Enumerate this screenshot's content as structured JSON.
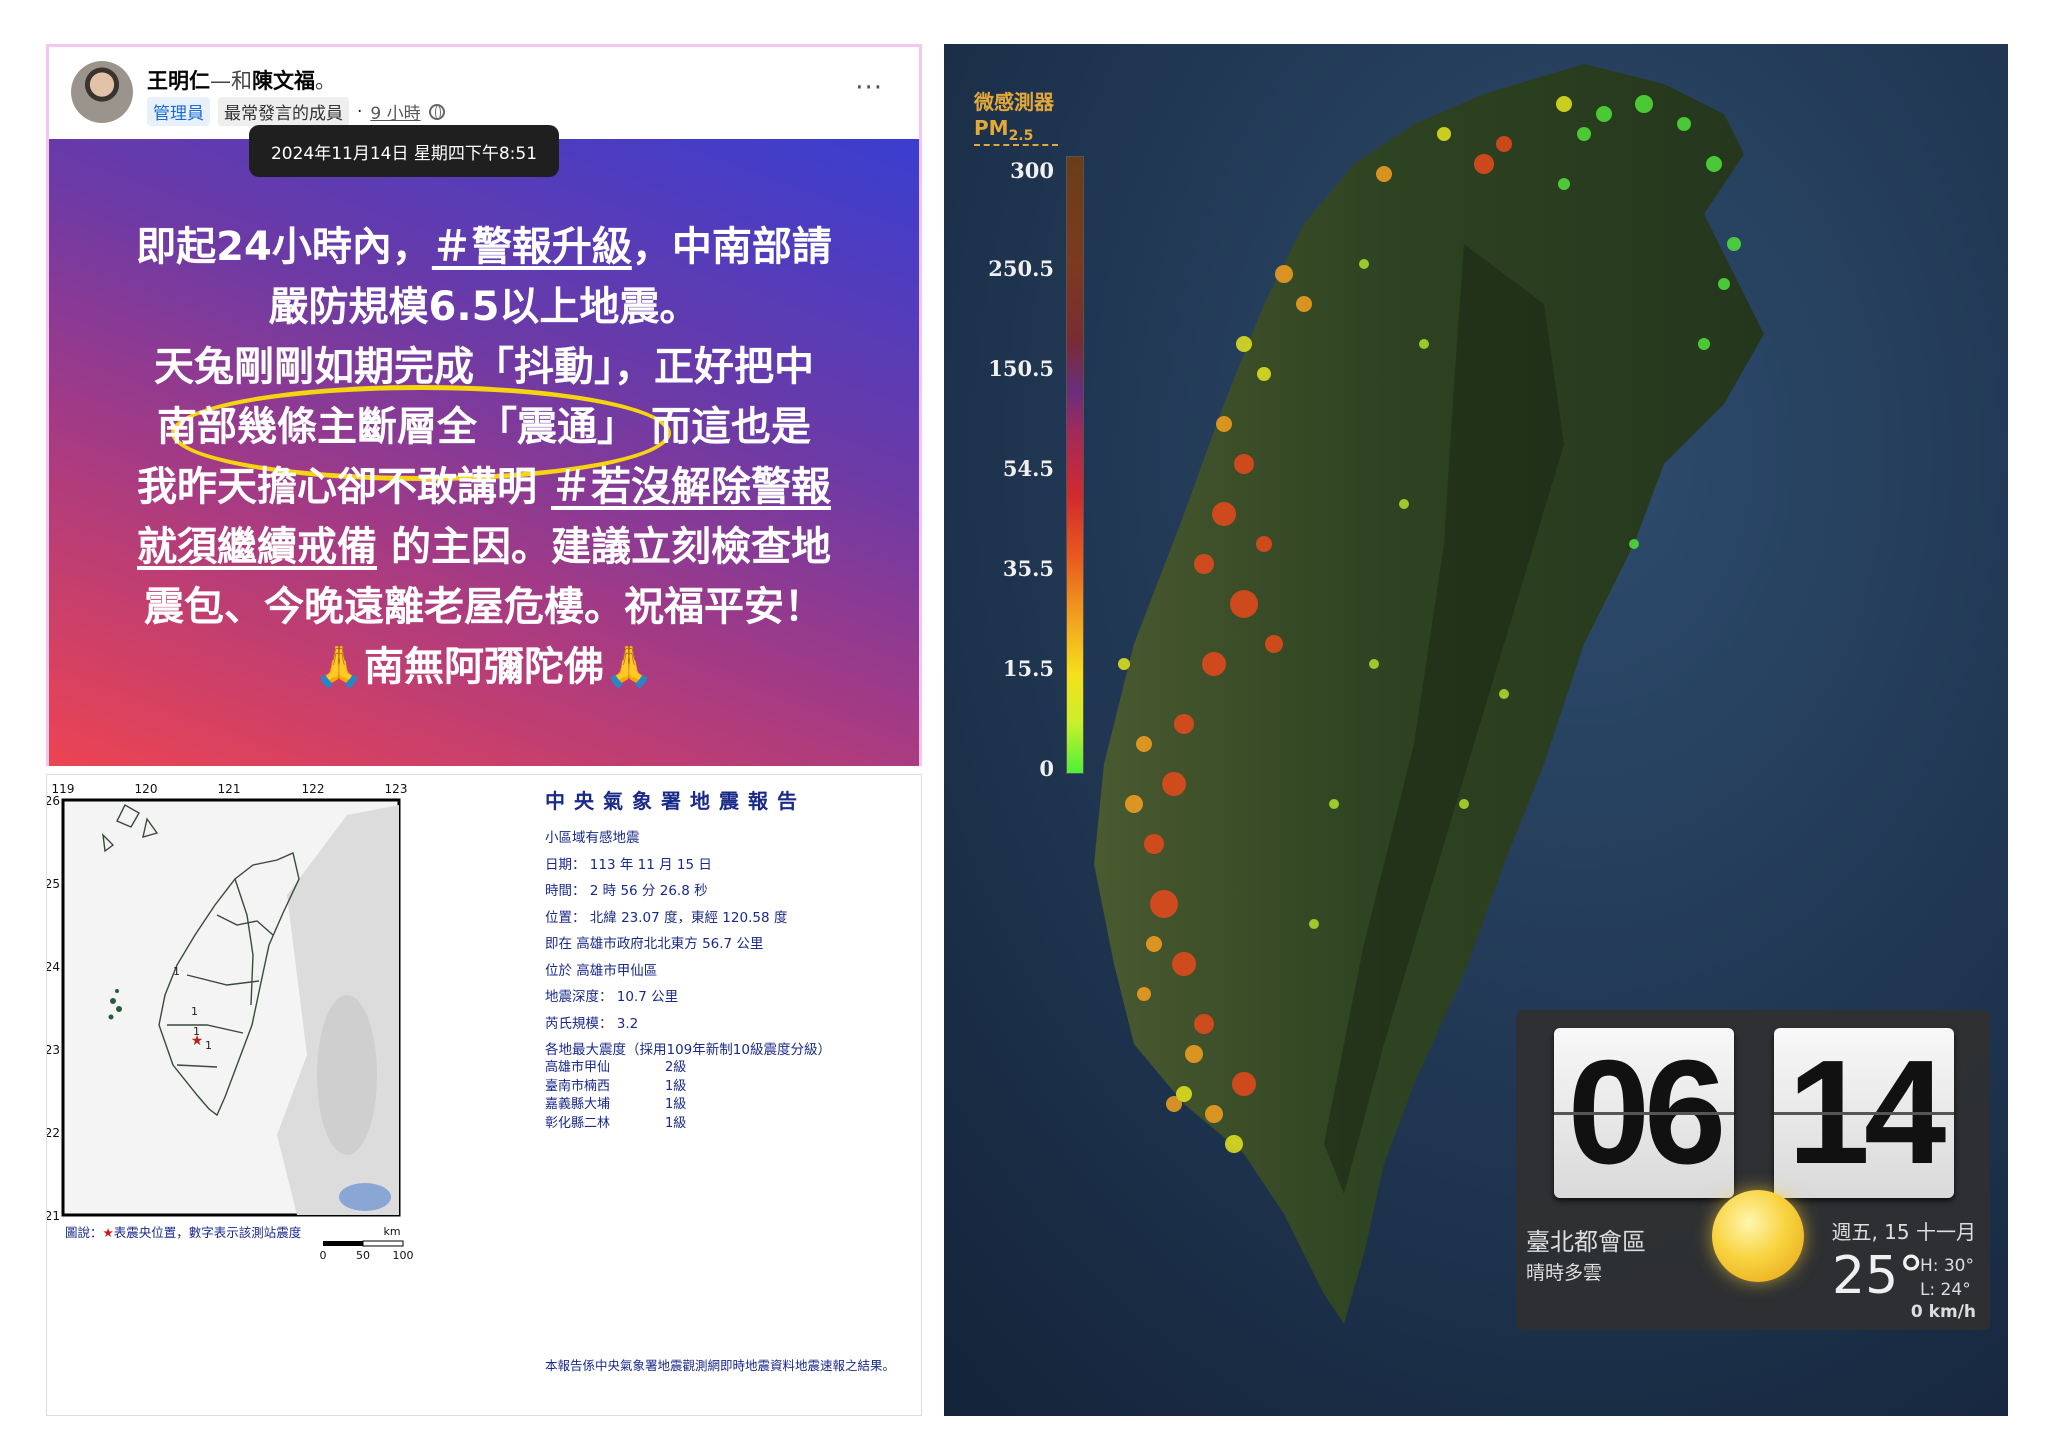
{
  "post": {
    "author": "王明仁",
    "with_text": "—和",
    "tagged": "陳文福",
    "suffix": "。",
    "role_badge": "管理員",
    "member_badge": "最常發言的成員",
    "separator": "·",
    "time": "9 小時",
    "more": "···",
    "tooltip": "2024年11月14日 星期四下午8:51",
    "body": {
      "l1a": "即起24小時內，",
      "l1tag": "＃警報升級",
      "l1b": "，中南部請",
      "l2": "嚴防規模6.5以上地震。",
      "l3": "天兔剛剛如期完成「抖動」，正好把中",
      "l4": "南部幾條主斷層全「震通」  而這也是",
      "l5a": "我昨天擔心卻不敢講明 ",
      "l5tag": "＃若沒解除警報",
      "l6tag": "就須繼續戒備",
      "l6b": " 的主因。建議立刻檢查地",
      "l7": "震包、今晚遠離老屋危樓。祝福平安！",
      "l8_pray": "🙏",
      "l8": "南無阿彌陀佛"
    }
  },
  "report": {
    "title": "中央氣象署地震報告",
    "subtitle": "小區域有感地震",
    "date": "日期： 113 年 11 月 15 日",
    "time": "時間： 2 時 56 分 26.8 秒",
    "position": "位置： 北緯 23.07 度，東經 120.58 度",
    "at": "即在 高雄市政府北北東方 56.7 公里",
    "located": "位於 高雄市甲仙區",
    "depth": "地震深度： 10.7 公里",
    "magnitude": "芮氏規模： 3.2",
    "intensity_header": "各地最大震度（採用109年新制10級震度分級）",
    "intensities": [
      {
        "loc": "高雄市甲仙",
        "level": "2級"
      },
      {
        "loc": "臺南市楠西",
        "level": "1級"
      },
      {
        "loc": "嘉義縣大埔",
        "level": "1級"
      },
      {
        "loc": "彰化縣二林",
        "level": "1級"
      }
    ],
    "footnote": "本報告係中央氣象署地震觀測網即時地震資料地震速報之結果。",
    "map_legend_prefix": "圖說：",
    "map_legend_star": "★",
    "map_legend": "表震央位置，數字表示該測站震度",
    "scale_unit": "km",
    "scale_ticks": [
      "0",
      "50",
      "100"
    ],
    "lon_ticks": [
      "119",
      "120",
      "121",
      "122",
      "123"
    ],
    "lat_ticks": [
      "26",
      "25",
      "24",
      "23",
      "22",
      "21"
    ],
    "station_labels": [
      "1",
      "1",
      "1",
      "1"
    ]
  },
  "pm_map": {
    "sensor_label": "微感測器",
    "pm_label": "PM",
    "pm_sub": "2.5",
    "scale_ticks": [
      "300",
      "250.5",
      "150.5",
      "54.5",
      "35.5",
      "15.5",
      "0"
    ]
  },
  "weather_widget": {
    "hour": "06",
    "minute": "14",
    "area": "臺北都會區",
    "condition": "晴時多雲",
    "date": "週五, 15 十一月",
    "temp": "25°",
    "high": "H: 30°",
    "low": "L: 24°",
    "wind": "0 km/h"
  }
}
